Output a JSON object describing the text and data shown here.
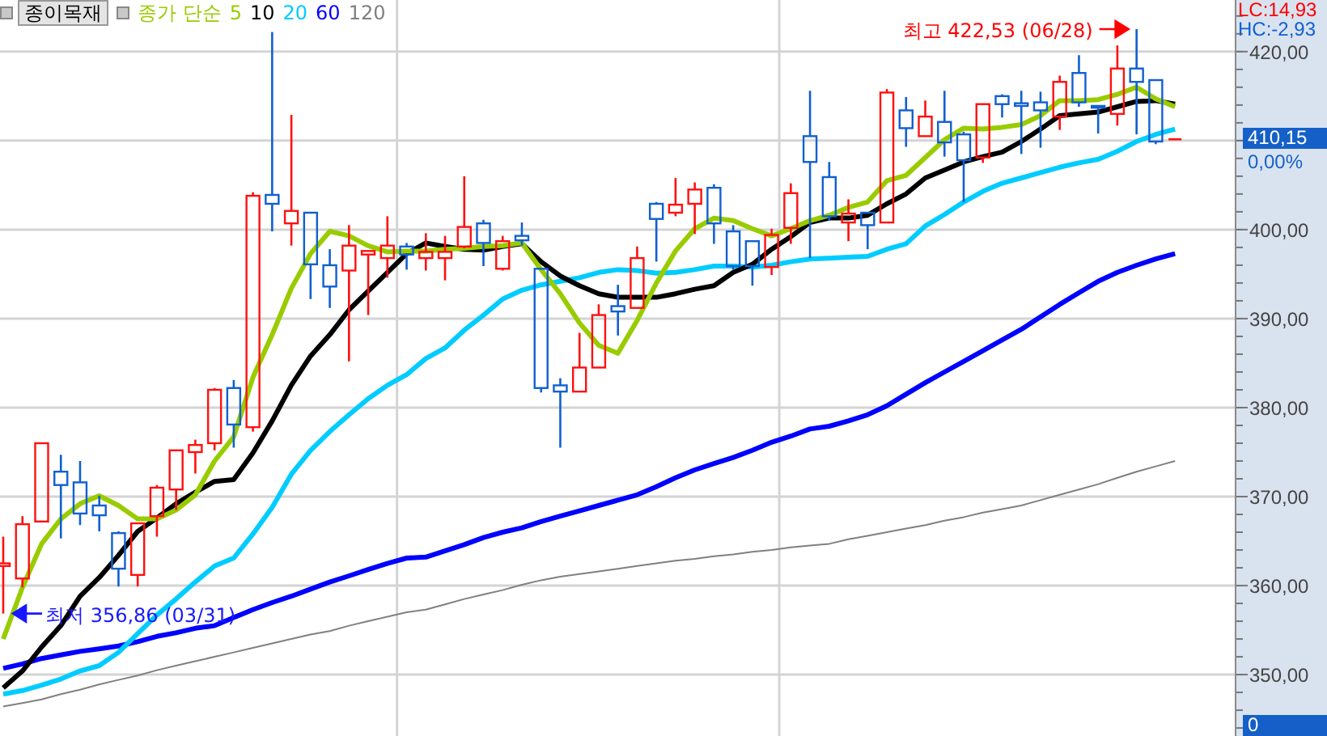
{
  "toolbar": {
    "sector_button": "종이목재",
    "legend_label": "종가 단순"
  },
  "chart_data": {
    "type": "candlestick",
    "grid": true,
    "ylim": [
      343.1,
      425.8
    ],
    "yticks": [
      {
        "value": 350,
        "label": "350,00"
      },
      {
        "value": 360,
        "label": "360,00"
      },
      {
        "value": 370,
        "label": "370,00"
      },
      {
        "value": 380,
        "label": "380,00"
      },
      {
        "value": 390,
        "label": "390,00"
      },
      {
        "value": 400,
        "label": "400,00"
      },
      {
        "value": 420,
        "label": "420,00"
      }
    ],
    "categories": [
      null,
      null,
      null,
      null,
      null,
      null,
      null,
      null,
      null,
      null,
      null,
      null,
      null,
      null,
      null,
      null,
      null,
      null,
      null,
      null,
      null,
      null,
      null,
      null,
      null,
      null,
      null,
      null,
      null,
      null,
      null,
      null,
      null,
      null,
      null,
      null,
      null,
      null,
      null,
      null,
      null,
      null,
      null,
      null,
      null,
      null,
      null,
      null,
      null,
      null,
      null,
      null,
      null,
      null,
      null,
      null,
      null,
      null,
      null,
      null,
      null,
      null
    ],
    "ohlc": [
      [
        362.2,
        365.5,
        356.86,
        362.5
      ],
      [
        360.8,
        367.8,
        359.8,
        366.9
      ],
      [
        367.2,
        376.0,
        367.1,
        376.0
      ],
      [
        372.8,
        374.7,
        365.3,
        371.3
      ],
      [
        371.6,
        374.0,
        366.8,
        368.1
      ],
      [
        369.0,
        370.1,
        366.1,
        367.9
      ],
      [
        365.9,
        366.1,
        359.9,
        361.9
      ],
      [
        361.2,
        367.0,
        359.9,
        367.0
      ],
      [
        367.8,
        371.3,
        365.5,
        371.0
      ],
      [
        370.8,
        375.2,
        368.5,
        375.2
      ],
      [
        375.0,
        376.4,
        372.6,
        375.8
      ],
      [
        376.0,
        382.2,
        375.2,
        382.0
      ],
      [
        382.2,
        383.1,
        375.5,
        378.1
      ],
      [
        377.8,
        404.2,
        377.3,
        403.8
      ],
      [
        403.9,
        422.2,
        399.8,
        402.9
      ],
      [
        400.7,
        412.9,
        398.2,
        402.1
      ],
      [
        401.9,
        401.9,
        392.2,
        396.1
      ],
      [
        396.0,
        397.8,
        391.2,
        393.6
      ],
      [
        395.4,
        400.5,
        385.2,
        398.2
      ],
      [
        397.2,
        397.6,
        390.4,
        397.6
      ],
      [
        396.8,
        401.5,
        394.6,
        398.2
      ],
      [
        398.1,
        398.5,
        395.5,
        397.2
      ],
      [
        396.8,
        399.6,
        395.4,
        397.5
      ],
      [
        396.8,
        399.3,
        394.3,
        397.5
      ],
      [
        398.1,
        406.0,
        397.9,
        400.3
      ],
      [
        400.7,
        401.1,
        395.9,
        398.5
      ],
      [
        395.6,
        399.3,
        395.4,
        398.7
      ],
      [
        399.3,
        400.8,
        398.2,
        398.8
      ],
      [
        395.6,
        395.6,
        381.7,
        382.2
      ],
      [
        382.5,
        383.3,
        375.5,
        381.8
      ],
      [
        381.8,
        388.4,
        381.8,
        384.5
      ],
      [
        384.5,
        391.6,
        384.5,
        390.4
      ],
      [
        391.4,
        393.8,
        388.1,
        390.8
      ],
      [
        391.2,
        398.1,
        391.2,
        396.8
      ],
      [
        402.9,
        403.1,
        396.4,
        401.2
      ],
      [
        401.9,
        405.8,
        401.5,
        402.8
      ],
      [
        402.9,
        405.3,
        399.5,
        404.5
      ],
      [
        404.7,
        405.1,
        398.4,
        400.7
      ],
      [
        399.8,
        400.5,
        395.5,
        395.9
      ],
      [
        398.7,
        398.7,
        393.7,
        395.9
      ],
      [
        395.8,
        400.1,
        394.9,
        399.4
      ],
      [
        400.2,
        405.2,
        398.4,
        404.1
      ],
      [
        410.5,
        415.6,
        396.8,
        407.6
      ],
      [
        405.9,
        407.6,
        401.0,
        401.5
      ],
      [
        400.8,
        403.4,
        398.7,
        401.8
      ],
      [
        401.9,
        401.9,
        397.8,
        400.5
      ],
      [
        400.8,
        415.8,
        400.8,
        415.4
      ],
      [
        413.4,
        414.9,
        409.3,
        411.4
      ],
      [
        410.5,
        414.5,
        410.5,
        412.7
      ],
      [
        412.1,
        415.6,
        408.2,
        409.8
      ],
      [
        410.7,
        411.0,
        403.1,
        407.8
      ],
      [
        408.1,
        414.1,
        407.5,
        414.1
      ],
      [
        415.0,
        415.2,
        412.6,
        414.1
      ],
      [
        414.2,
        415.6,
        408.5,
        413.9
      ],
      [
        414.3,
        415.5,
        409.2,
        413.4
      ],
      [
        412.7,
        417.3,
        411.2,
        416.6
      ],
      [
        417.6,
        419.6,
        413.8,
        414.3
      ],
      [
        413.9,
        413.9,
        410.8,
        413.7
      ],
      [
        413.0,
        420.7,
        411.7,
        418.1
      ],
      [
        418.1,
        422.53,
        410.7,
        416.6
      ],
      [
        416.8,
        416.8,
        409.6,
        409.9
      ],
      [
        410.15,
        410.15,
        410.15,
        410.15
      ]
    ],
    "series": [
      {
        "name": "5",
        "color": "#99cc00",
        "type": "line",
        "values": [
          354.0,
          359.8,
          364.7,
          367.5,
          369.2,
          370.1,
          369.0,
          367.5,
          367.5,
          368.5,
          370.2,
          374.0,
          376.7,
          383.4,
          388.2,
          393.4,
          397.3,
          399.8,
          399.3,
          398.2,
          397.5,
          397.6,
          397.6,
          397.8,
          397.9,
          398.1,
          398.2,
          398.5,
          395.5,
          392.8,
          389.5,
          387.0,
          386.1,
          389.8,
          394.0,
          397.6,
          400.1,
          401.3,
          401.0,
          400.1,
          399.3,
          400.1,
          401.0,
          401.6,
          402.5,
          403.1,
          405.5,
          406.1,
          408.1,
          410.1,
          411.4,
          411.3,
          411.5,
          411.8,
          412.8,
          414.5,
          414.5,
          414.6,
          415.2,
          416.0,
          414.7,
          413.8
        ]
      },
      {
        "name": "10",
        "color": "#000000",
        "type": "line",
        "values": [
          348.5,
          350.4,
          353.1,
          355.5,
          358.8,
          360.9,
          363.4,
          366.1,
          367.6,
          369.2,
          370.5,
          371.7,
          371.9,
          374.9,
          378.5,
          382.5,
          385.8,
          388.2,
          391.0,
          393.1,
          395.2,
          397.3,
          398.5,
          398.1,
          397.8,
          397.7,
          398.1,
          398.4,
          396.4,
          394.8,
          393.7,
          392.8,
          392.4,
          392.4,
          392.4,
          392.8,
          393.3,
          393.7,
          395.2,
          396.1,
          397.8,
          399.2,
          400.8,
          401.3,
          401.3,
          401.6,
          402.9,
          404.0,
          405.8,
          406.7,
          407.6,
          408.2,
          408.7,
          409.9,
          411.3,
          412.8,
          413.0,
          413.2,
          413.8,
          414.4,
          414.5,
          414.1
        ]
      },
      {
        "name": "20",
        "color": "#00ccff",
        "type": "line",
        "values": [
          347.8,
          348.2,
          348.8,
          349.5,
          350.4,
          351.0,
          352.5,
          354.6,
          356.7,
          358.5,
          360.4,
          362.2,
          363.1,
          365.8,
          368.8,
          372.5,
          375.2,
          377.3,
          379.2,
          381.0,
          382.5,
          383.7,
          385.5,
          386.7,
          388.7,
          390.4,
          392.2,
          393.2,
          393.8,
          394.2,
          394.6,
          395.2,
          395.5,
          395.4,
          395.1,
          395.2,
          395.5,
          395.9,
          395.9,
          395.8,
          396.0,
          396.4,
          396.7,
          396.8,
          396.9,
          397.0,
          397.8,
          398.4,
          400.4,
          401.7,
          403.1,
          404.3,
          405.2,
          405.8,
          406.4,
          407.0,
          407.5,
          407.9,
          408.8,
          409.9,
          410.7,
          411.3
        ]
      },
      {
        "name": "60",
        "color": "#0000ff",
        "type": "line",
        "values": [
          350.7,
          351.2,
          351.8,
          352.2,
          352.6,
          352.9,
          353.2,
          353.7,
          354.3,
          354.7,
          355.2,
          355.5,
          356.4,
          357.3,
          358.1,
          358.8,
          359.6,
          360.4,
          361.1,
          361.8,
          362.5,
          363.1,
          363.2,
          363.9,
          364.6,
          365.4,
          366.0,
          366.5,
          367.2,
          367.8,
          368.4,
          369.0,
          369.6,
          370.2,
          371.1,
          372.1,
          373.0,
          373.7,
          374.4,
          375.2,
          376.1,
          376.8,
          377.6,
          377.9,
          378.5,
          379.2,
          380.2,
          381.5,
          382.8,
          384.0,
          385.2,
          386.4,
          387.6,
          388.8,
          390.2,
          391.6,
          392.9,
          394.2,
          395.2,
          396.0,
          396.7,
          397.3
        ]
      },
      {
        "name": "120",
        "color": "#808080",
        "type": "line",
        "values": [
          346.4,
          346.8,
          347.2,
          347.8,
          348.3,
          348.9,
          349.4,
          349.9,
          350.5,
          351.0,
          351.5,
          352.0,
          352.5,
          353.0,
          353.5,
          354.0,
          354.5,
          354.9,
          355.5,
          356.0,
          356.5,
          357.0,
          357.3,
          357.9,
          358.5,
          359.0,
          359.5,
          360.1,
          360.6,
          361.0,
          361.3,
          361.6,
          361.9,
          362.2,
          362.5,
          362.8,
          363.0,
          363.3,
          363.5,
          363.8,
          364.0,
          364.3,
          364.5,
          364.7,
          365.2,
          365.6,
          366.0,
          366.4,
          366.8,
          367.3,
          367.7,
          368.2,
          368.6,
          369.0,
          369.6,
          370.2,
          370.8,
          371.4,
          372.1,
          372.8,
          373.4,
          374.0
        ]
      }
    ],
    "annotations": [
      "최고 422,53 (06/28)",
      "최저 356,86 (03/31)"
    ]
  },
  "axis": {
    "lc": "LC:14,93",
    "hc": "HC:-2,93",
    "current_price": "410,15",
    "change": "0,00%",
    "bottom_badge": "0"
  }
}
